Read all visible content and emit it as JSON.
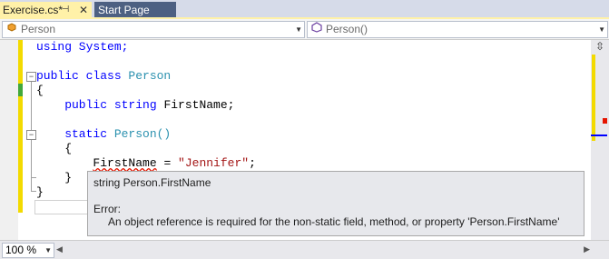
{
  "tabs": [
    {
      "label": "Exercise.cs*",
      "pin": "⊣",
      "close": "✕"
    },
    {
      "label": "Start Page"
    }
  ],
  "nav": {
    "left": {
      "icon": "class-icon",
      "text": "Person"
    },
    "right": {
      "icon": "method-icon",
      "text": "Person()"
    }
  },
  "code": {
    "l1": "using System;",
    "l3a": "public class ",
    "l3b": "Person",
    "l4": "{",
    "l5a": "    public string ",
    "l5b": "FirstName;",
    "l7a": "    static ",
    "l7b": "Person()",
    "l8": "    {",
    "l9a": "        ",
    "l9b": "FirstName",
    "l9c": " = ",
    "l9d": "\"Jennifer\"",
    "l9e": ";",
    "l10": "    }",
    "l11": "}"
  },
  "tooltip": {
    "signature": "string Person.FirstName",
    "error_label": "Error:",
    "error_message": "An object reference is required for the non-static field, method, or property 'Person.FirstName'"
  },
  "zoom": {
    "value": "100 %"
  },
  "colors": {
    "keyword": "#0000ff",
    "type": "#2b91af",
    "string": "#a31515",
    "tab_active": "#fff1a8"
  }
}
